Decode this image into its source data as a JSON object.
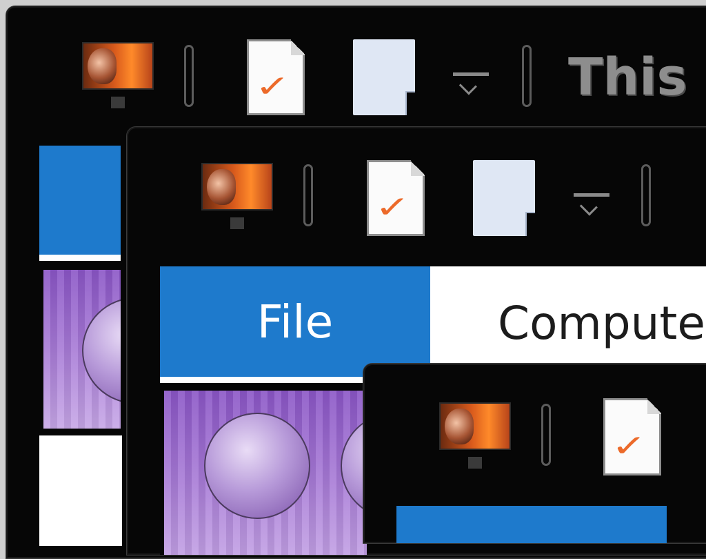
{
  "window_title": "This PC",
  "ribbon": {
    "file_tab": "File",
    "computer_tab": "Computer"
  },
  "quick_access_toolbar": {
    "items": [
      "this-pc-icon",
      "properties-icon",
      "new-folder-icon",
      "customize-dropdown-icon"
    ]
  },
  "colors": {
    "window_background": "#060606",
    "file_tab": "#1e7acc",
    "ribbon_background": "#ffffff",
    "title_text": "#8d8d8d"
  }
}
